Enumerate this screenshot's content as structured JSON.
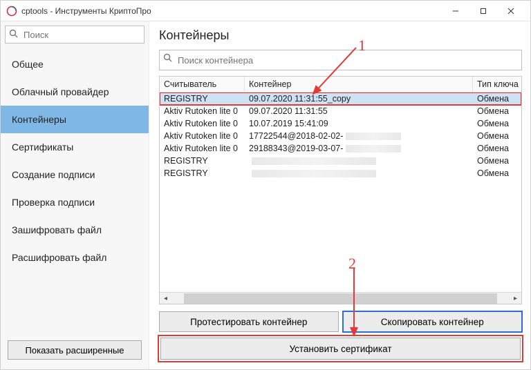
{
  "window": {
    "title": "cptools - Инструменты КриптоПро"
  },
  "sidebar": {
    "search_placeholder": "Поиск",
    "items": [
      {
        "label": "Общее"
      },
      {
        "label": "Облачный провайдер"
      },
      {
        "label": "Контейнеры",
        "selected": true
      },
      {
        "label": "Сертификаты"
      },
      {
        "label": "Создание подписи"
      },
      {
        "label": "Проверка подписи"
      },
      {
        "label": "Зашифровать файл"
      },
      {
        "label": "Расшифровать файл"
      }
    ],
    "show_extended": "Показать расширенные"
  },
  "main": {
    "title": "Контейнеры",
    "search_placeholder": "Поиск контейнера",
    "columns": {
      "reader": "Считыватель",
      "container": "Контейнер",
      "keytype": "Тип ключа"
    },
    "rows": [
      {
        "reader": "REGISTRY",
        "container": "09.07.2020 11:31:55_copy",
        "type": "Обмена",
        "selected": true,
        "highlight": true
      },
      {
        "reader": "Aktiv Rutoken lite 0",
        "container": "09.07.2020 11:31:55",
        "type": "Обмена"
      },
      {
        "reader": "Aktiv Rutoken lite 0",
        "container": "10.07.2019 15:41:09",
        "type": "Обмена"
      },
      {
        "reader": "Aktiv Rutoken lite 0",
        "container": "17722544@2018-02-02-",
        "type": "Обмена",
        "redacted": true
      },
      {
        "reader": "Aktiv Rutoken lite 0",
        "container": "29188343@2019-03-07-",
        "type": "Обмена",
        "redacted": true
      },
      {
        "reader": "REGISTRY",
        "container": "",
        "type": "Обмена",
        "redacted": true
      },
      {
        "reader": "REGISTRY",
        "container": "",
        "type": "Обмена",
        "redacted": true
      }
    ],
    "buttons": {
      "test": "Протестировать контейнер",
      "copy": "Скопировать контейнер",
      "install": "Установить сертификат"
    }
  },
  "annotations": {
    "one": "1",
    "two": "2"
  }
}
